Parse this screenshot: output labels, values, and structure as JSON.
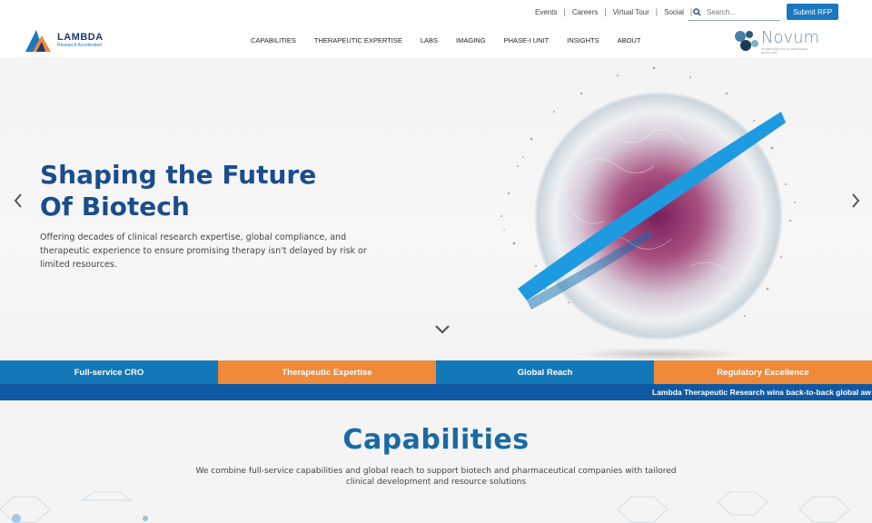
{
  "utility": {
    "links": [
      "Events",
      "Careers",
      "Virtual Tour",
      "Social"
    ],
    "search_placeholder": "Search...",
    "submit_rfp": "Submit RFP"
  },
  "logo": {
    "name": "LAMBDA",
    "tagline": "Research Accelerated"
  },
  "nav": {
    "items": [
      "CAPABILITIES",
      "THERAPEUTIC EXPERTISE",
      "LABS",
      "IMAGING",
      "PHASE-I UNIT",
      "INSIGHTS",
      "ABOUT"
    ]
  },
  "partner_logo": {
    "name": "Novum",
    "tagline": "PHARMACEUTICAL RESEARCH SERVICES"
  },
  "hero": {
    "title": "Shaping the Future Of Biotech",
    "description": "Offering decades of clinical research expertise, global compliance, and therapeutic experience to ensure promising therapy isn't delayed by risk or limited resources."
  },
  "tabs": [
    {
      "label": "Full-service CRO",
      "color": "#1378b8"
    },
    {
      "label": "Therapeutic Expertise",
      "color": "#ef8a3b"
    },
    {
      "label": "Global Reach",
      "color": "#1378b8"
    },
    {
      "label": "Regulatory Excellence",
      "color": "#ef8a3b"
    }
  ],
  "ticker": {
    "text": "Lambda Therapeutic Research wins back-to-back global aw"
  },
  "capabilities": {
    "title": "Capabilities",
    "description": "We combine full-service capabilities and global reach to support biotech and pharmaceutical companies with tailored clinical development and resource solutions"
  },
  "colors": {
    "brand_blue": "#1a4d8c",
    "accent_blue": "#1378b8",
    "accent_orange": "#ef8a3b",
    "ticker_blue": "#0f59a3"
  }
}
